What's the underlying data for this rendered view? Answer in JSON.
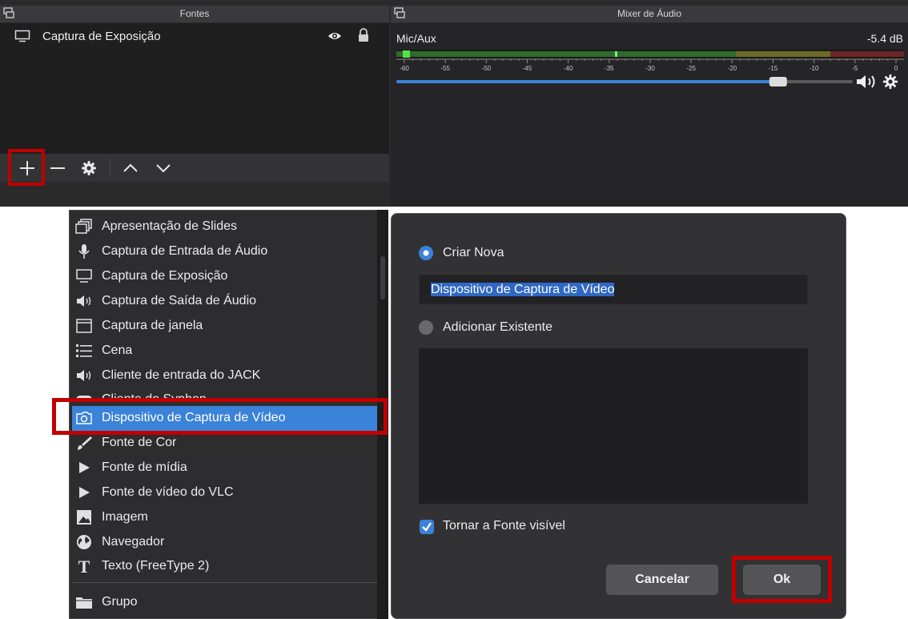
{
  "sources_panel": {
    "title": "Fontes",
    "sources": [
      {
        "label": "Captura de Exposição",
        "icon": "monitor-icon",
        "visible": true,
        "locked": true
      }
    ],
    "toolbar": {
      "add": "plus-icon",
      "remove": "minus-icon",
      "properties": "gear-icon",
      "move_up": "chevron-up-icon",
      "move_down": "chevron-down-icon"
    }
  },
  "mixer_panel": {
    "title": "Mixer de Áudio",
    "channel": {
      "name": "Mic/Aux",
      "level_db": "-5.4 dB",
      "volume_fraction": 0.85,
      "scale_ticks": [
        "-60",
        "-55",
        "-50",
        "-45",
        "-40",
        "-35",
        "-30",
        "-25",
        "-20",
        "-15",
        "-10",
        "-5",
        "0"
      ]
    }
  },
  "add_source_menu": {
    "items": [
      {
        "label": "Apresentação de Slides",
        "icon": "slideshow-icon"
      },
      {
        "label": "Captura de Entrada de Áudio",
        "icon": "microphone-icon"
      },
      {
        "label": "Captura de Exposição",
        "icon": "monitor-icon"
      },
      {
        "label": "Captura de Saída de Áudio",
        "icon": "speaker-icon"
      },
      {
        "label": "Captura de janela",
        "icon": "window-icon"
      },
      {
        "label": "Cena",
        "icon": "list-icon"
      },
      {
        "label": "Cliente de entrada do JACK",
        "icon": "speaker-icon"
      },
      {
        "label": "Cliente do Syphon",
        "icon": "gamepad-icon"
      },
      {
        "label": "Dispositivo de Captura de Vídeo",
        "icon": "camera-icon",
        "selected": true
      },
      {
        "label": "Fonte de Cor",
        "icon": "brush-icon"
      },
      {
        "label": "Fonte de mídia",
        "icon": "play-icon"
      },
      {
        "label": "Fonte de vídeo do VLC",
        "icon": "play-icon"
      },
      {
        "label": "Imagem",
        "icon": "image-icon"
      },
      {
        "label": "Navegador",
        "icon": "globe-icon"
      },
      {
        "label": "Texto (FreeType 2)",
        "icon": "text-icon"
      }
    ],
    "group_item": {
      "label": "Grupo",
      "icon": "folder-icon"
    }
  },
  "create_source_dialog": {
    "create_new_label": "Criar Nova",
    "create_new_selected": true,
    "name_value": "Dispositivo de Captura de Vídeo",
    "add_existing_label": "Adicionar Existente",
    "make_visible_label": "Tornar a Fonte visível",
    "make_visible_checked": true,
    "cancel_label": "Cancelar",
    "ok_label": "Ok"
  },
  "colors": {
    "accent": "#3b82d9",
    "highlight_box": "#c00000",
    "meter_green": "#3fa33a",
    "meter_yellow": "#a6a33a",
    "meter_red": "#a43a3a"
  }
}
